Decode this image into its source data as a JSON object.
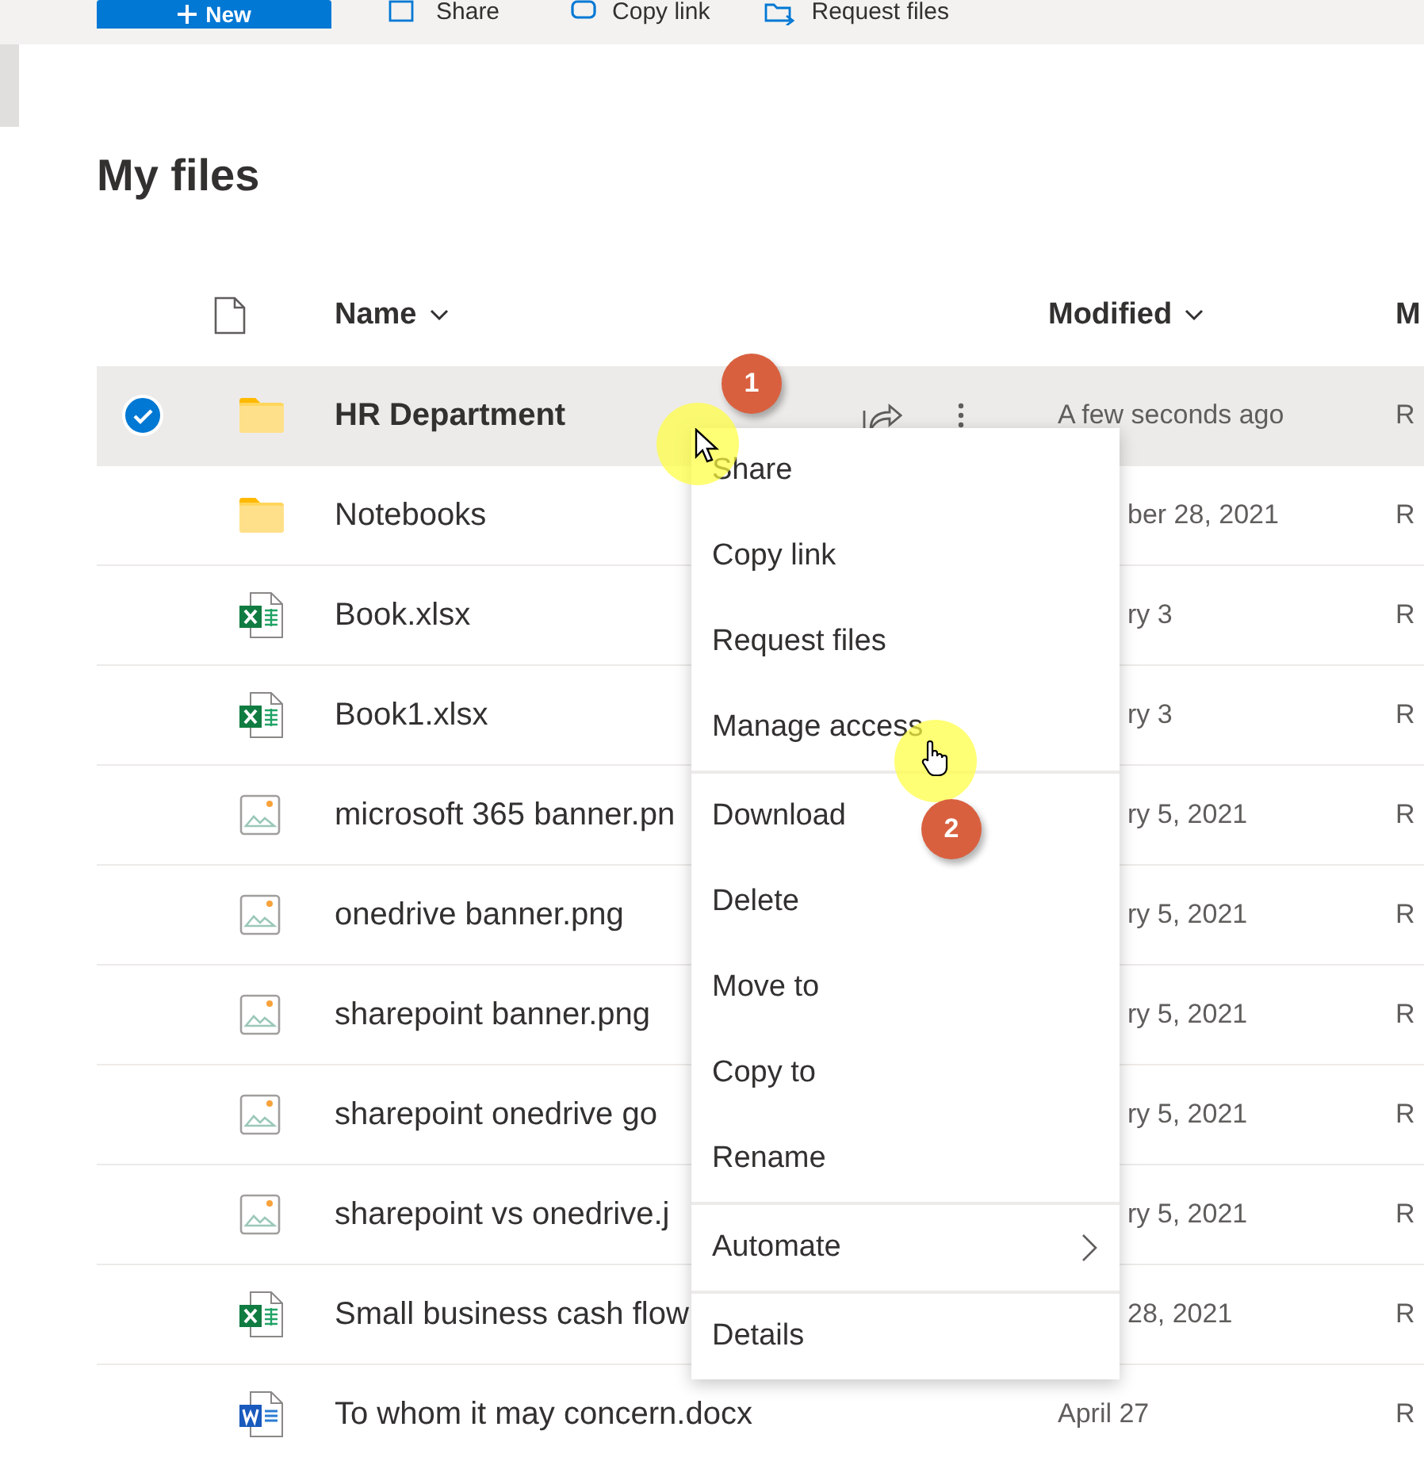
{
  "toolbar": {
    "new_button": "New",
    "actions": [
      {
        "kind": "share",
        "label": "Share"
      },
      {
        "kind": "link",
        "label": "Copy link"
      },
      {
        "kind": "request",
        "label": "Request files"
      }
    ]
  },
  "page_title": "My files",
  "table": {
    "columns": [
      {
        "label": "Name",
        "sortable": true
      },
      {
        "label": "Modified",
        "sortable": true
      },
      {
        "label": "M",
        "sortable": false
      }
    ],
    "rows": [
      {
        "kind": "folder",
        "name": "HR Department",
        "modified": "A few seconds ago",
        "column_3": "R",
        "selected": true,
        "obscured": false
      },
      {
        "kind": "folder",
        "name": "Notebooks",
        "modified": "ber 28, 2021",
        "column_3": "R",
        "selected": false,
        "obscured": true
      },
      {
        "kind": "excel",
        "name": "Book.xlsx",
        "modified": "ry 3",
        "column_3": "R",
        "selected": false,
        "obscured": true
      },
      {
        "kind": "excel",
        "name": "Book1.xlsx",
        "modified": "ry 3",
        "column_3": "R",
        "selected": false,
        "obscured": true
      },
      {
        "kind": "image",
        "name": "microsoft 365 banner.pn",
        "modified": "ry 5, 2021",
        "column_3": "R",
        "selected": false,
        "obscured": true
      },
      {
        "kind": "image",
        "name": "onedrive banner.png",
        "modified": "ry 5, 2021",
        "column_3": "R",
        "selected": false,
        "obscured": true
      },
      {
        "kind": "image",
        "name": "sharepoint banner.png",
        "modified": "ry 5, 2021",
        "column_3": "R",
        "selected": false,
        "obscured": true
      },
      {
        "kind": "image",
        "name": "sharepoint onedrive go",
        "modified": "ry 5, 2021",
        "column_3": "R",
        "selected": false,
        "obscured": true
      },
      {
        "kind": "image",
        "name": "sharepoint vs onedrive.j",
        "modified": "ry 5, 2021",
        "column_3": "R",
        "selected": false,
        "obscured": true
      },
      {
        "kind": "excel",
        "name": "Small business cash flow",
        "modified": "28, 2021",
        "column_3": "R",
        "selected": false,
        "obscured": true
      },
      {
        "kind": "word",
        "name": "To whom it may concern.docx",
        "modified": "April 27",
        "column_3": "R",
        "selected": false,
        "obscured": false
      }
    ]
  },
  "context_menu": {
    "sections": [
      [
        {
          "label": "Share",
          "submenu": false
        },
        {
          "label": "Copy link",
          "submenu": false
        },
        {
          "label": "Request files",
          "submenu": false
        },
        {
          "label": "Manage access",
          "submenu": false
        }
      ],
      [
        {
          "label": "Download",
          "submenu": false
        },
        {
          "label": "Delete",
          "submenu": false
        },
        {
          "label": "Move to",
          "submenu": false
        },
        {
          "label": "Copy to",
          "submenu": false
        },
        {
          "label": "Rename",
          "submenu": false
        }
      ],
      [
        {
          "label": "Automate",
          "submenu": true
        }
      ],
      [
        {
          "label": "Details",
          "submenu": false
        }
      ]
    ]
  },
  "step_badges": [
    "1",
    "2"
  ]
}
